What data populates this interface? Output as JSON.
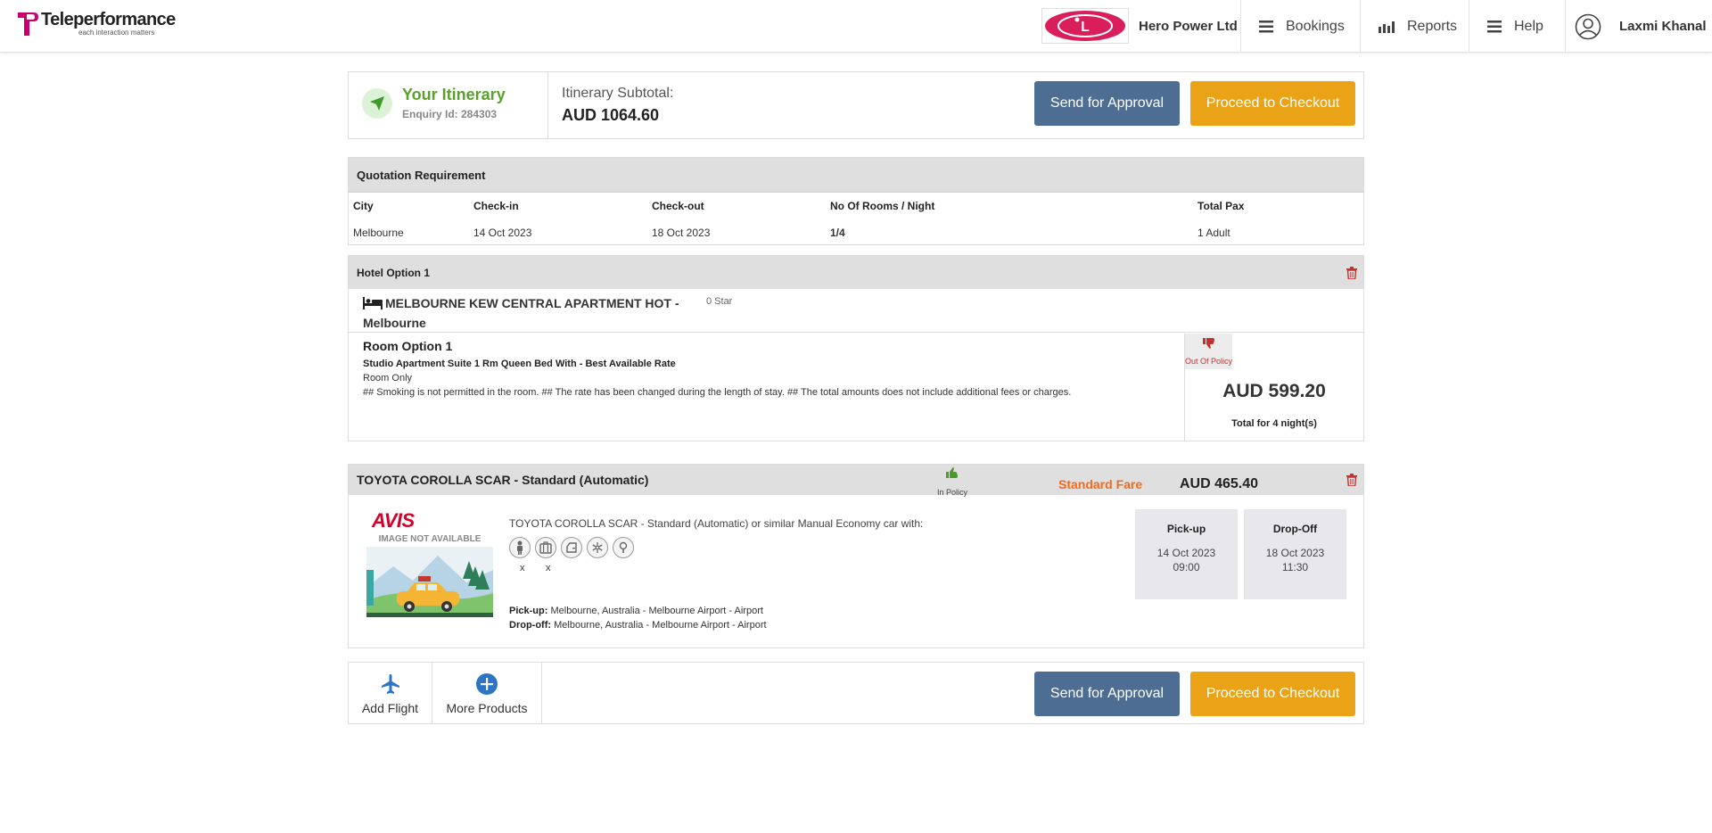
{
  "header": {
    "brand_name": "Teleperformance",
    "brand_tagline": "each interaction matters",
    "company_logo_text": "L",
    "company_name": "Hero Power Ltd",
    "nav": {
      "bookings": "Bookings",
      "reports": "Reports",
      "help": "Help",
      "user": "Laxmi Khanal"
    }
  },
  "itinerary": {
    "title": "Your Itinerary",
    "enquiry": "Enquiry Id: 284303",
    "subtotal_label": "Itinerary Subtotal:",
    "subtotal_value": "AUD  1064.60",
    "send_for_approval": "Send for Approval",
    "proceed_to_checkout": "Proceed to Checkout"
  },
  "quotation": {
    "title": "Quotation Requirement",
    "headers": [
      "City",
      "Check-in",
      "Check-out",
      "No Of Rooms / Night",
      "Total Pax"
    ],
    "values": [
      "Melbourne",
      "14 Oct 2023",
      "18 Oct 2023",
      "1/4",
      "1 Adult"
    ]
  },
  "hotel": {
    "option_label": "Hotel Option 1",
    "name": "MELBOURNE KEW CENTRAL APARTMENT HOT - Melbourne",
    "star": "0 Star",
    "room_title": "Room Option 1",
    "room_desc": "Studio Apartment Suite 1 Rm Queen Bed With - Best Available Rate",
    "board": "Room Only",
    "notes": "## Smoking is not permitted in the room. ## The rate has been changed during the length of stay. ## The total amounts does not include additional fees or charges.",
    "policy": "Out Of Policy",
    "price": "AUD 599.20",
    "price_note": "Total for 4 night(s)"
  },
  "car": {
    "title": "TOYOTA COROLLA SCAR - Standard (Automatic)",
    "policy": "In Policy",
    "fare_type": "Standard Fare",
    "price": "AUD 465.40",
    "vendor": "AVIS",
    "image_label": "IMAGE NOT AVAILABLE",
    "description": "TOYOTA COROLLA SCAR - Standard (Automatic) or similar Manual Economy car with:",
    "feature_icons": [
      "passenger-icon",
      "luggage-icon",
      "door-icon",
      "air-conditioning-icon",
      "transmission-icon"
    ],
    "passengers": "x",
    "luggage": "x",
    "pickup_label": "Pick-up:",
    "pickup_location": "Melbourne, Australia - Melbourne Airport - Airport",
    "dropoff_label": "Drop-off:",
    "dropoff_location": "Melbourne, Australia - Melbourne Airport - Airport",
    "pickup_box": {
      "title": "Pick-up",
      "date": "14 Oct 2023",
      "time": "09:00"
    },
    "dropoff_box": {
      "title": "Drop-Off",
      "date": "18 Oct 2023",
      "time": "11:30"
    }
  },
  "bottom": {
    "add_flight": "Add Flight",
    "more_products": "More Products",
    "send_for_approval": "Send for Approval",
    "proceed_to_checkout": "Proceed to Checkout"
  },
  "colors": {
    "brand_pink": "#c8006e",
    "approval_button": "#4d6d93",
    "checkout_button": "#eaa317",
    "itinerary_green": "#5aa02c",
    "out_of_policy_red": "#c9302c",
    "in_policy_green": "#4b9a2a",
    "standard_fare_orange": "#f26b1d",
    "icon_blue": "#2d74c4"
  }
}
